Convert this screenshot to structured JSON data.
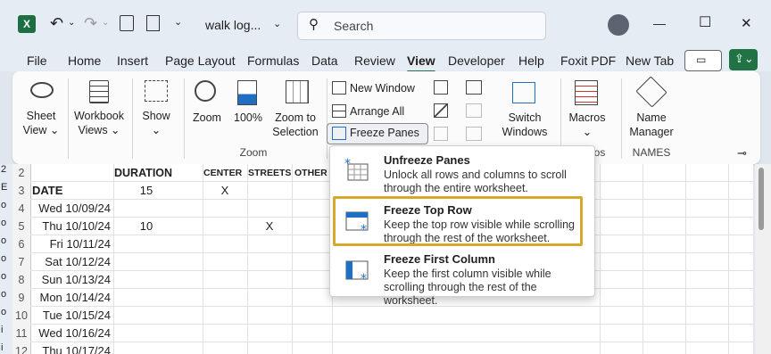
{
  "titlebar": {
    "filename": "walk log...",
    "search_placeholder": "Search",
    "minimize": "—",
    "maximize": "☐",
    "close": "✕"
  },
  "tabs": [
    "File",
    "Home",
    "Insert",
    "Page Layout",
    "Formulas",
    "Data",
    "Review",
    "View",
    "Developer",
    "Help",
    "Foxit PDF",
    "New Tab"
  ],
  "active_tab": "View",
  "ribbon": {
    "sheet_view": [
      "Sheet",
      "View ⌄"
    ],
    "workbook_views": [
      "Workbook",
      "Views ⌄"
    ],
    "show": [
      "Show",
      "⌄"
    ],
    "zoom": "Zoom",
    "zoom100": "100%",
    "zoom_selection": [
      "Zoom to",
      "Selection"
    ],
    "zoom_group": "Zoom",
    "new_window": "New Window",
    "arrange_all": "Arrange All",
    "freeze_panes": "Freeze Panes ⌄",
    "switch_windows": [
      "Switch",
      "Windows ⌄"
    ],
    "macros": [
      "Macros",
      "⌄"
    ],
    "macros_group": "os",
    "name_manager": [
      "Name",
      "Manager"
    ],
    "names_group": "NAMES"
  },
  "sheet": {
    "rows": [
      {
        "num": "2",
        "a": "",
        "b": "DURATION",
        "c": "CENTER",
        "d": "STREETS",
        "e": "OTHER"
      },
      {
        "num": "3",
        "a": "DATE",
        "b": "15",
        "c": "X",
        "d": "",
        "e": ""
      },
      {
        "num": "4",
        "a": "Wed 10/09/24",
        "b": "",
        "c": "",
        "d": "",
        "e": ""
      },
      {
        "num": "5",
        "a": "Thu 10/10/24",
        "b": "10",
        "c": "",
        "d": "X",
        "e": ""
      },
      {
        "num": "6",
        "a": "Fri 10/11/24",
        "b": "",
        "c": "",
        "d": "",
        "e": ""
      },
      {
        "num": "7",
        "a": "Sat 10/12/24",
        "b": "",
        "c": "",
        "d": "",
        "e": ""
      },
      {
        "num": "8",
        "a": "Sun 10/13/24",
        "b": "",
        "c": "",
        "d": "",
        "e": ""
      },
      {
        "num": "9",
        "a": "Mon 10/14/24",
        "b": "",
        "c": "",
        "d": "",
        "e": ""
      },
      {
        "num": "10",
        "a": "Tue 10/15/24",
        "b": "",
        "c": "",
        "d": "",
        "e": ""
      },
      {
        "num": "11",
        "a": "Wed 10/16/24",
        "b": "",
        "c": "",
        "d": "",
        "e": ""
      },
      {
        "num": "12",
        "a": "Thu 10/17/24",
        "b": "",
        "c": "",
        "d": "",
        "e": ""
      }
    ],
    "left_edge": [
      "2",
      "E",
      "o",
      "o",
      "o",
      "o",
      "o",
      "o",
      "o",
      "i",
      "i"
    ]
  },
  "menu": {
    "items": [
      {
        "title": "Unfreeze Panes",
        "desc": "Unlock all rows and columns to scroll through the entire worksheet."
      },
      {
        "title": "Freeze Top Row",
        "desc": "Keep the top row visible while scrolling through the rest of the worksheet."
      },
      {
        "title": "Freeze First Column",
        "desc": "Keep the first column visible while scrolling through the rest of the worksheet."
      }
    ]
  },
  "colors": {
    "accent": "#217346",
    "highlight": "#d7a92b",
    "icon_blue": "#1f6fc5"
  }
}
